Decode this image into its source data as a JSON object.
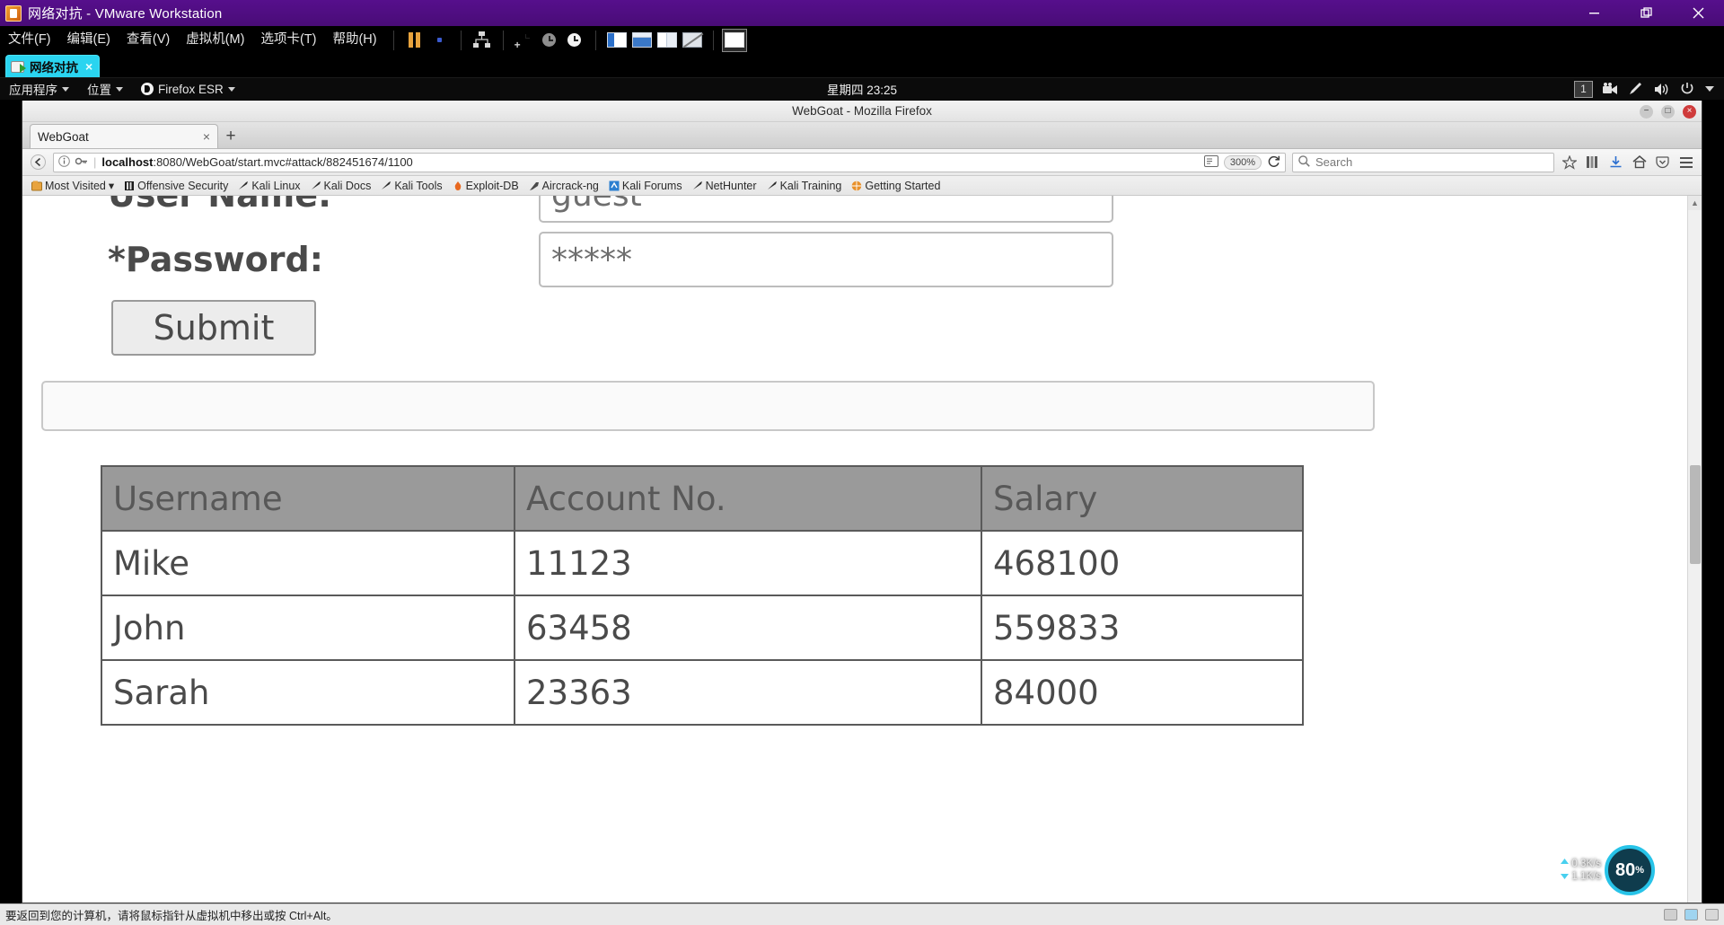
{
  "vmware": {
    "title": "网络对抗 - VMware Workstation",
    "window_buttons": {
      "minimize": "minimize-icon",
      "maximize": "restore-icon",
      "close": "close-icon"
    },
    "menu": [
      "文件(F)",
      "编辑(E)",
      "查看(V)",
      "虚拟机(M)",
      "选项卡(T)",
      "帮助(H)"
    ],
    "toolbar_icons": [
      "pause-icon",
      "record-dot-icon",
      "network-editor-icon",
      "snapshot-take-icon",
      "snapshot-revert-icon",
      "snapshot-manager-icon",
      "view-sidebar-icon",
      "view-thumbnail-icon",
      "view-console-icon",
      "view-none-icon",
      "fullscreen-icon"
    ],
    "tab": {
      "label": "网络对抗",
      "icon": "vm-powered-on-icon",
      "close": "×"
    },
    "statusbar": {
      "hint": "要返回到您的计算机，请将鼠标指针从虚拟机中移出或按 Ctrl+Alt。",
      "devices": [
        "hard-disk-icon",
        "network-adapter-icon",
        "usb-icon"
      ]
    }
  },
  "kali_panel": {
    "applications_label": "应用程序",
    "places_label": "位置",
    "browser_label": "Firefox ESR",
    "clock": "星期四 23:25",
    "workspace": "1",
    "tray_icons": [
      "screen-recorder-icon",
      "settings-pen-icon",
      "volume-icon",
      "power-icon",
      "chevron-down-icon"
    ]
  },
  "firefox": {
    "window_title": "WebGoat - Mozilla Firefox",
    "window_buttons": {
      "minimize": "−",
      "maximize": "□",
      "close": "×"
    },
    "tab": {
      "title": "WebGoat",
      "close": "×"
    },
    "new_tab": "+",
    "nav": {
      "back": "back-arrow-icon",
      "identity": "page-info-icon",
      "permission": "key-icon",
      "url_host": "localhost",
      "url_path": ":8080/WebGoat/start.mvc#attack/882451674/1100",
      "reader_icon": "reader-mode-icon",
      "zoom_level": "300%",
      "reload": "reload-icon",
      "search_placeholder": "Search",
      "search_icon": "search-icon",
      "bookmark_star": "star-icon",
      "library": "library-icon",
      "downloads": "downloads-icon",
      "home": "home-icon",
      "pocket": "pocket-icon",
      "menu": "hamburger-menu-icon"
    },
    "bookmarks": [
      {
        "label": "Most Visited",
        "icon": "folder-icon",
        "caret": "▾"
      },
      {
        "label": "Offensive Security",
        "icon": "offsec-icon"
      },
      {
        "label": "Kali Linux",
        "icon": "dragon-icon"
      },
      {
        "label": "Kali Docs",
        "icon": "dragon-icon"
      },
      {
        "label": "Kali Tools",
        "icon": "dragon-icon"
      },
      {
        "label": "Exploit-DB",
        "icon": "flame-icon"
      },
      {
        "label": "Aircrack-ng",
        "icon": "feather-icon"
      },
      {
        "label": "Kali Forums",
        "icon": "forum-icon"
      },
      {
        "label": "NetHunter",
        "icon": "dragon-icon"
      },
      {
        "label": "Kali Training",
        "icon": "graduation-icon"
      },
      {
        "label": "Getting Started",
        "icon": "globe-icon"
      }
    ]
  },
  "webgoat": {
    "form": {
      "username_label": "User Name:",
      "username_value": "guest",
      "password_label": "*Password:",
      "password_value": "*****",
      "submit_label": "Submit",
      "message_bar_text": ""
    },
    "table": {
      "headers": [
        "Username",
        "Account No.",
        "Salary"
      ],
      "rows": [
        [
          "Mike",
          "11123",
          "468100"
        ],
        [
          "John",
          "63458",
          "559833"
        ],
        [
          "Sarah",
          "23363",
          "84000"
        ]
      ]
    }
  },
  "system_monitor": {
    "upload_rate": "0.3K/s",
    "download_rate": "1.1K/s",
    "cpu_percent": "80",
    "cpu_unit": "%"
  }
}
